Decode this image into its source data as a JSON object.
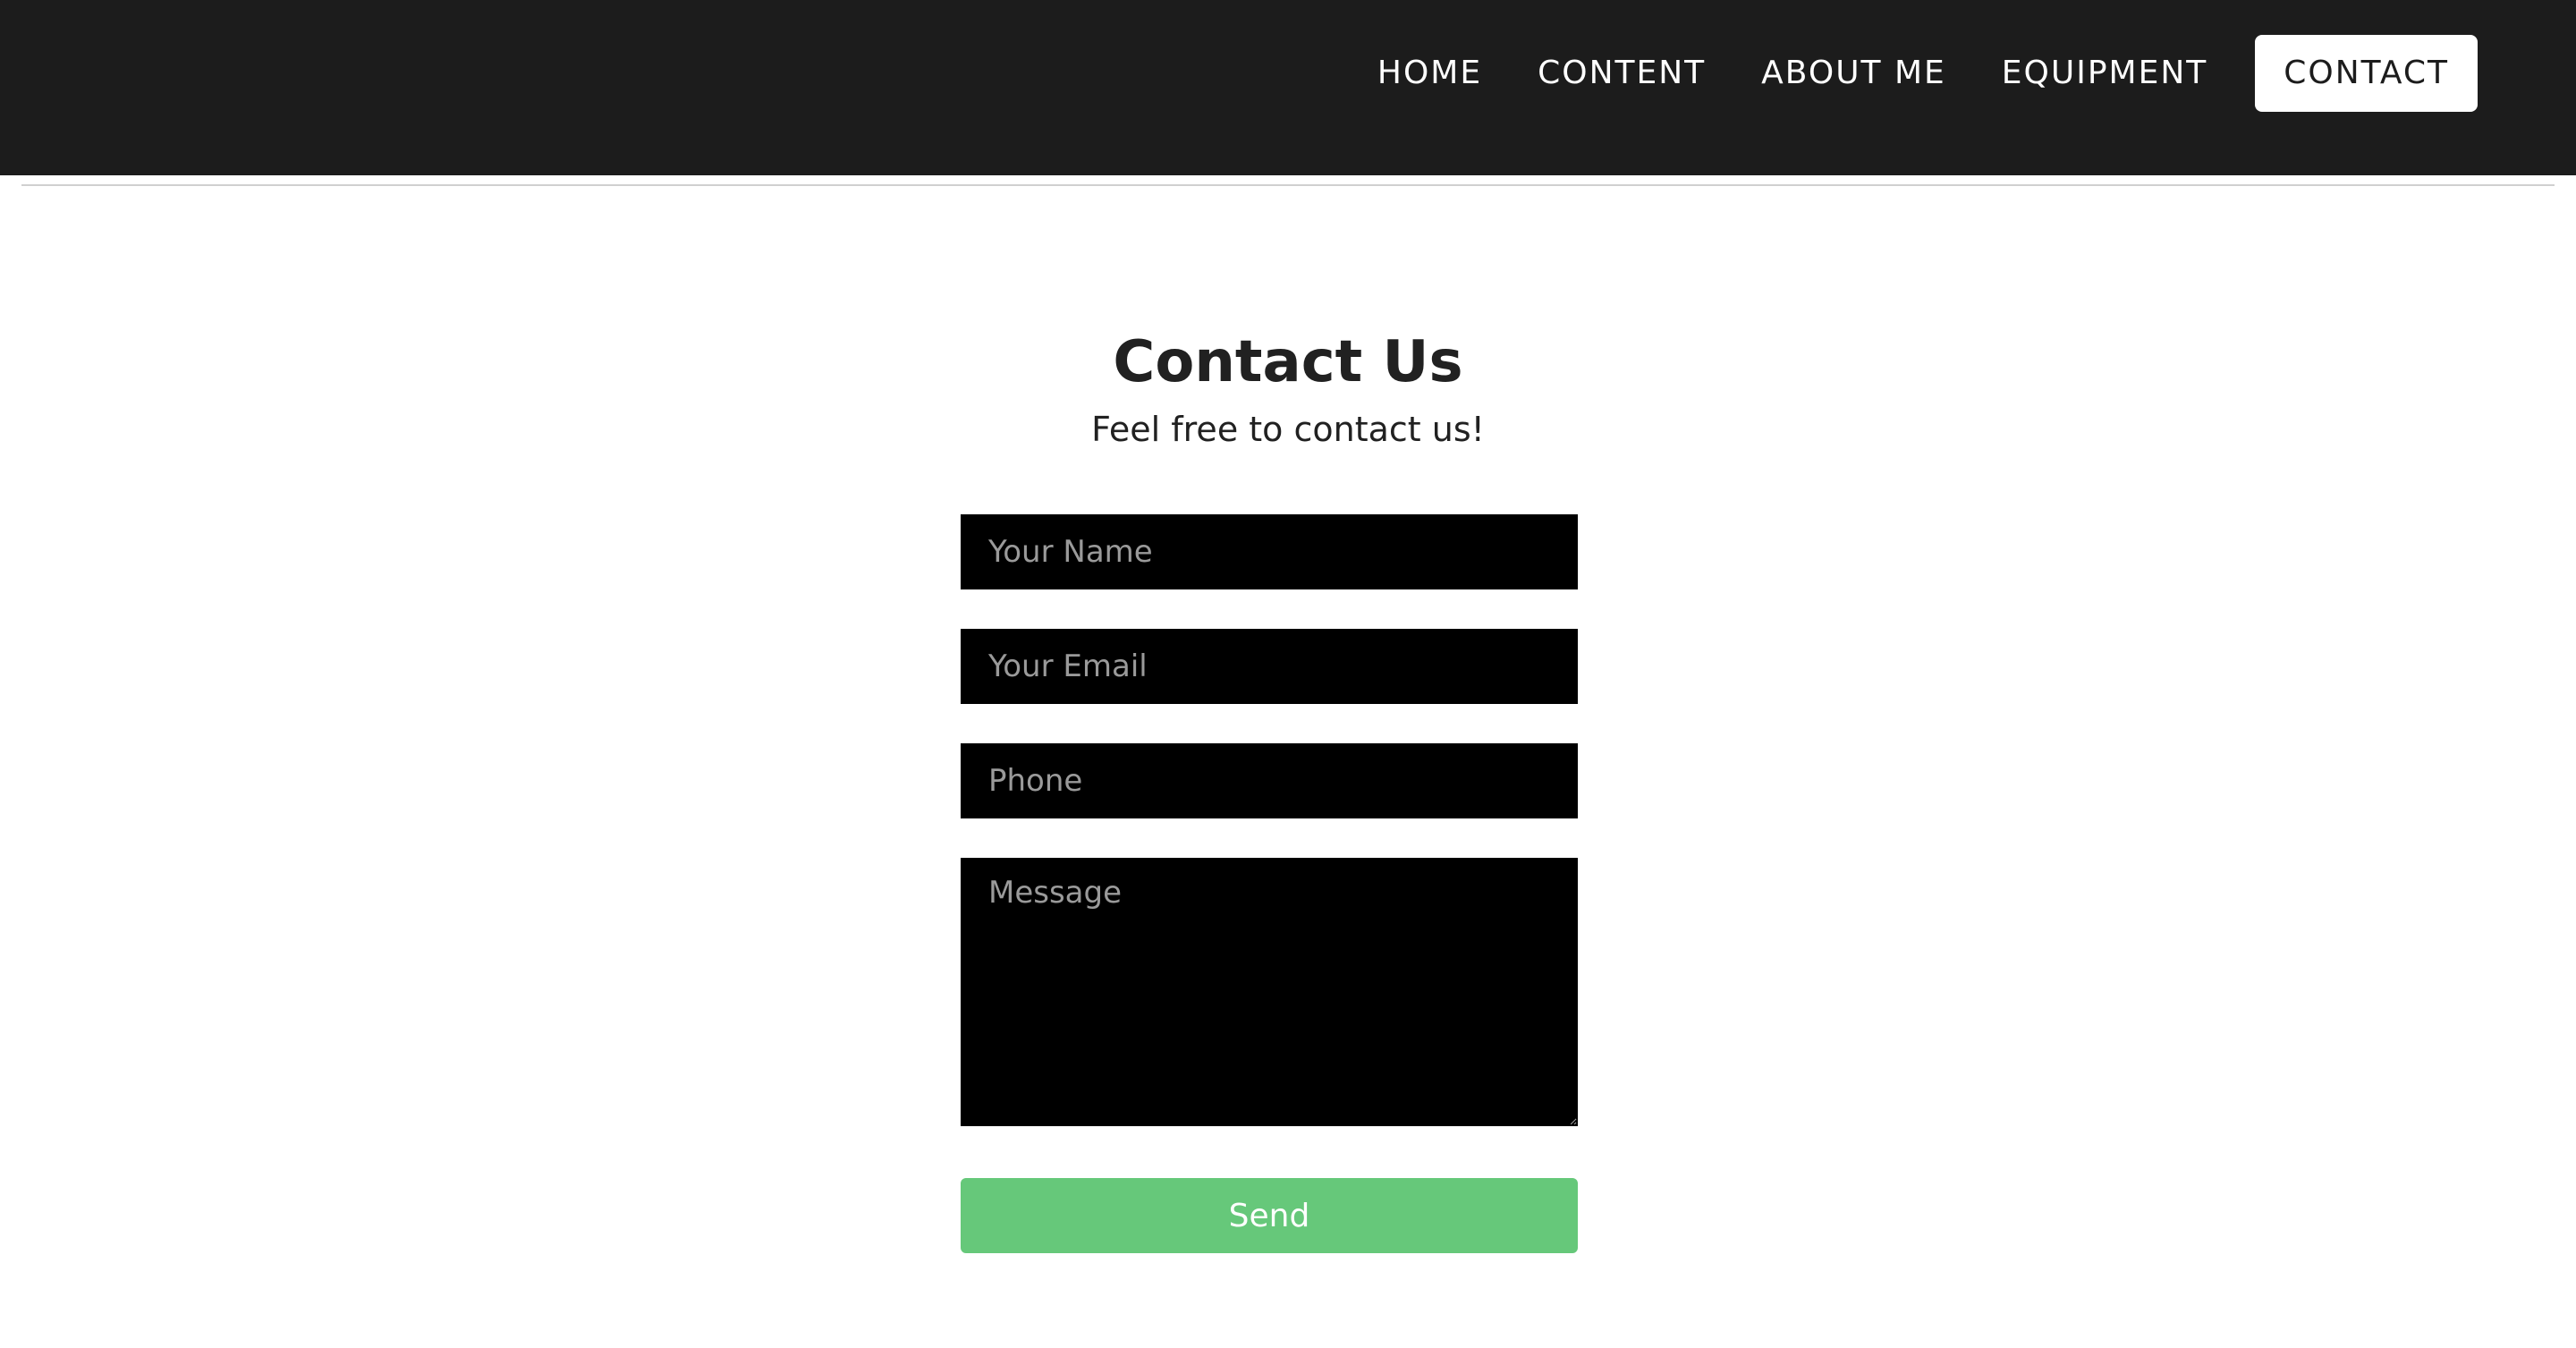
{
  "nav": {
    "items": [
      {
        "label": "HOME"
      },
      {
        "label": "CONTENT"
      },
      {
        "label": "ABOUT ME"
      },
      {
        "label": "EQUIPMENT"
      },
      {
        "label": "CONTACT",
        "active": true
      }
    ]
  },
  "page": {
    "title": "Contact Us",
    "subtitle": "Feel free to contact us!"
  },
  "form": {
    "name_placeholder": "Your Name",
    "email_placeholder": "Your Email",
    "phone_placeholder": "Phone",
    "message_placeholder": "Message",
    "send_label": "Send"
  },
  "colors": {
    "header_bg": "#1c1c1c",
    "input_bg": "#000000",
    "send_button": "#66c87a"
  }
}
